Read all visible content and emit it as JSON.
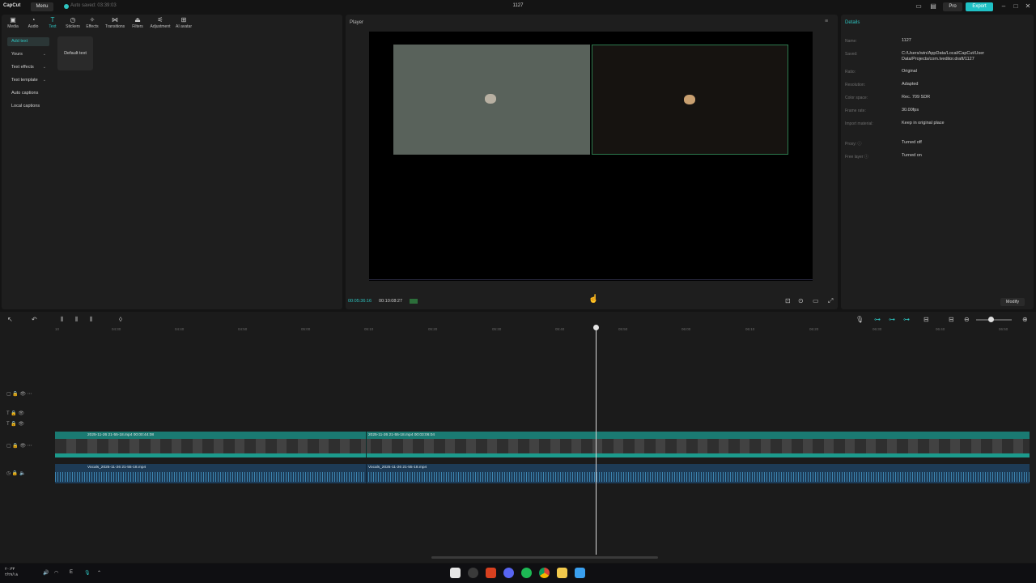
{
  "titlebar": {
    "logo": "CapCut",
    "menu": "Menu",
    "autosave": "Auto saved: 03:39:03",
    "project_title": "1127",
    "pro_label": "Pro",
    "export_label": "Export"
  },
  "toolbar": {
    "items": [
      {
        "label": "Media",
        "icon": "media-icon"
      },
      {
        "label": "Audio",
        "icon": "audio-icon"
      },
      {
        "label": "Text",
        "icon": "text-icon"
      },
      {
        "label": "Stickers",
        "icon": "stickers-icon"
      },
      {
        "label": "Effects",
        "icon": "effects-icon"
      },
      {
        "label": "Transitions",
        "icon": "transitions-icon"
      },
      {
        "label": "Filters",
        "icon": "filters-icon"
      },
      {
        "label": "Adjustment",
        "icon": "adjustment-icon"
      },
      {
        "label": "AI avatar",
        "icon": "ai-avatar-icon"
      }
    ],
    "active": "Text"
  },
  "text_sidebar": {
    "items": [
      "Add text",
      "Yours",
      "Text effects",
      "Text template",
      "Auto captions",
      "Local captions"
    ],
    "default_card": "Default text"
  },
  "player": {
    "title": "Player",
    "timecode_current": "00:05:36:16",
    "timecode_total": "00:10:08:27"
  },
  "details": {
    "title": "Details",
    "rows": [
      {
        "label": "Name:",
        "value": "1127"
      },
      {
        "label": "Saved:",
        "value": "C:/Users/win/AppData/Local/CapCut/User Data/Projects/com.lveditor.draft/1127"
      },
      {
        "label": "Ratio:",
        "value": "Original"
      },
      {
        "label": "Resolution:",
        "value": "Adapted"
      },
      {
        "label": "Color space:",
        "value": "Rec. 709 SDR"
      },
      {
        "label": "Frame rate:",
        "value": "30.00fps"
      },
      {
        "label": "Import material:",
        "value": "Keep in original place"
      },
      {
        "label": "Proxy: ⓘ",
        "value": "Turned off"
      },
      {
        "label": "Free layer ⓘ",
        "value": "Turned on"
      }
    ],
    "modify_label": "Modify"
  },
  "timeline": {
    "ruler": [
      "10",
      "04:30",
      "04:40",
      "04:50",
      "05:00",
      "05:10",
      "05:20",
      "05:30",
      "05:40",
      "05:50",
      "06:00",
      "06:10",
      "06:20",
      "06:30",
      "06:40",
      "06:50"
    ],
    "video_clips": [
      {
        "label": "2025-11-26 21-55-18.mp4   00:00:44:08"
      },
      {
        "label": "2025-11-26 21-55-18.mp4   00:03:06:04"
      }
    ],
    "audio_clips": [
      {
        "label": "Vocals_2025-11-26 21-55-18.mp4"
      },
      {
        "label": "Vocals_2025-11-26 21-55-18.mp4"
      }
    ]
  },
  "taskbar": {
    "time": "۲۰:۳۳",
    "date": "۲/۲۷/۱۸",
    "lang": "E"
  }
}
